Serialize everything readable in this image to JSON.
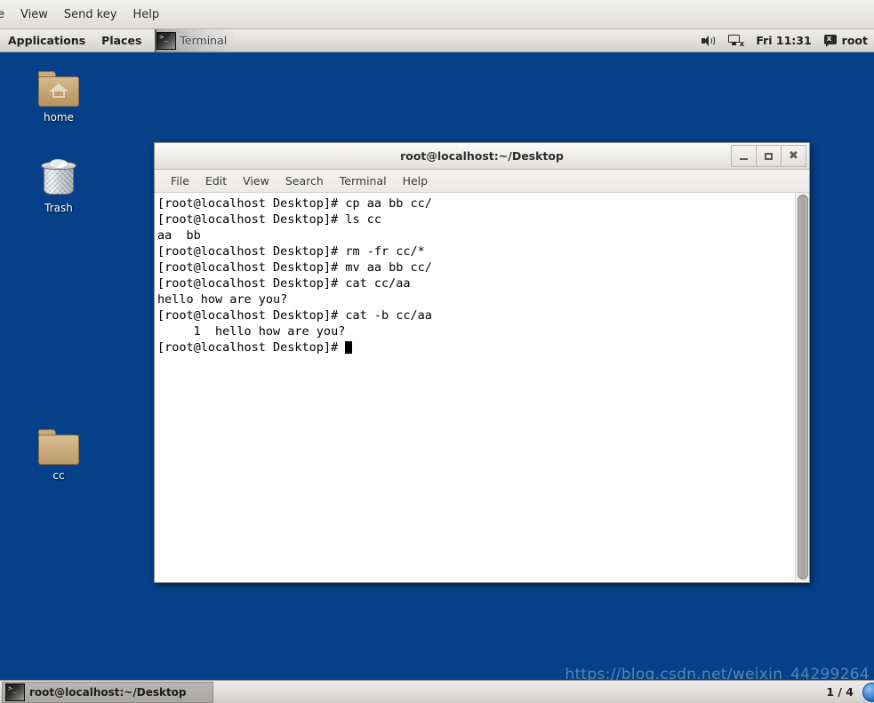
{
  "vm_menubar": {
    "items": [
      {
        "label": "e",
        "name": "vm-menu-file-clipped"
      },
      {
        "label": "View",
        "name": "vm-menu-view"
      },
      {
        "label": "Send key",
        "name": "vm-menu-send-key"
      },
      {
        "label": "Help",
        "name": "vm-menu-help"
      }
    ]
  },
  "gnome_panel": {
    "applications_label": "Applications",
    "places_label": "Places",
    "window_button_label": "Terminal",
    "window_button_icon": "terminal-icon",
    "tray": {
      "speaker_icon": "speaker-volume-icon",
      "network_display_icon": "display-disconnected-icon",
      "clock": "Fri 11:31",
      "message_icon": "message-bubble-icon",
      "user_label": "root"
    }
  },
  "desktop": {
    "background_color": "#054089",
    "icons": [
      {
        "label": "home",
        "icon": "home-folder-icon",
        "name": "desktop-icon-home"
      },
      {
        "label": "Trash",
        "icon": "trash-can-icon",
        "name": "desktop-icon-trash"
      },
      {
        "label": "cc",
        "icon": "folder-icon",
        "name": "desktop-icon-cc"
      }
    ]
  },
  "terminal_window": {
    "title": "root@localhost:~/Desktop",
    "window_buttons": {
      "minimize": "minimize-icon",
      "maximize": "maximize-icon",
      "close": "close-icon"
    },
    "menu": [
      {
        "label": "File",
        "name": "term-menu-file"
      },
      {
        "label": "Edit",
        "name": "term-menu-edit"
      },
      {
        "label": "View",
        "name": "term-menu-view"
      },
      {
        "label": "Search",
        "name": "term-menu-search"
      },
      {
        "label": "Terminal",
        "name": "term-menu-terminal"
      },
      {
        "label": "Help",
        "name": "term-menu-help"
      }
    ],
    "lines": [
      "[root@localhost Desktop]# cp aa bb cc/",
      "[root@localhost Desktop]# ls cc",
      "aa  bb",
      "[root@localhost Desktop]# rm -fr cc/*",
      "[root@localhost Desktop]# mv aa bb cc/",
      "[root@localhost Desktop]# cat cc/aa",
      "hello how are you?",
      "[root@localhost Desktop]# cat -b cc/aa",
      "     1  hello how are you?"
    ],
    "prompt": "[root@localhost Desktop]# ",
    "foreground_color": "#000000",
    "background_color": "#ffffff"
  },
  "bottom_panel": {
    "task_button_label": "root@localhost:~/Desktop",
    "task_button_icon": "terminal-icon",
    "workspace_indicator": "1 / 4"
  },
  "watermark": "https://blog.csdn.net/weixin_44299264"
}
